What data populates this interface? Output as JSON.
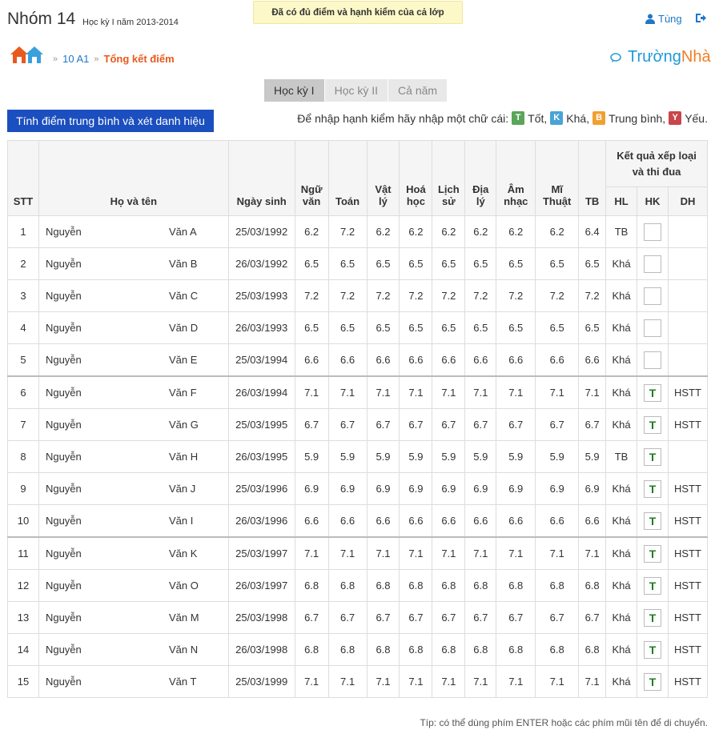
{
  "header": {
    "group": "Nhóm 14",
    "term": "Học kỳ I năm 2013-2014",
    "notice": "Đã có đủ điểm và hạnh kiểm của cả lớp",
    "user": "Tùng",
    "brand_1": "Trường",
    "brand_2": "Nhà"
  },
  "breadcrumb": {
    "class": "10 A1",
    "current": "Tổng kết điểm"
  },
  "tabs": [
    {
      "label": "Học kỳ I",
      "active": true
    },
    {
      "label": "Học kỳ II",
      "active": false
    },
    {
      "label": "Cả năm",
      "active": false
    }
  ],
  "calc_button": "Tính điểm trung bình và xét danh hiệu",
  "hint": {
    "prefix": "Để nhập hạnh kiểm hãy nhập một chữ cái:",
    "items": [
      {
        "letter": "T",
        "label": "Tốt,",
        "color": "#5aa55a"
      },
      {
        "letter": "K",
        "label": "Khá,",
        "color": "#4aa3d6"
      },
      {
        "letter": "B",
        "label": "Trung bình,",
        "color": "#f0a030"
      },
      {
        "letter": "Y",
        "label": "Yếu.",
        "color": "#c9464a"
      }
    ]
  },
  "table": {
    "headers": {
      "stt": "STT",
      "name": "Họ và tên",
      "dob": "Ngày sinh",
      "nguvan_1": "Ngữ",
      "nguvan_2": "văn",
      "toan": "Toán",
      "vatly_1": "Vật",
      "vatly_2": "lý",
      "hoahoc_1": "Hoá",
      "hoahoc_2": "học",
      "lichsu_1": "Lịch",
      "lichsu_2": "sử",
      "diaLy_1": "Địa",
      "diaLy_2": "lý",
      "amnhac_1": "Âm",
      "amnhac_2": "nhạc",
      "mithuat_1": "Mĩ",
      "mithuat_2": "Thuật",
      "tb": "TB",
      "result_1": "Kết quả xếp loại",
      "result_2": "và thi đua",
      "hl": "HL",
      "hk": "HK",
      "dh": "DH"
    },
    "rows": [
      {
        "stt": "1",
        "first": "Nguyễn",
        "last": "Văn A",
        "dob": "25/03/1992",
        "scores": [
          "6.2",
          "7.2",
          "6.2",
          "6.2",
          "6.2",
          "6.2",
          "6.2",
          "6.2"
        ],
        "tb": "6.4",
        "hl": "TB",
        "hk": "",
        "dh": ""
      },
      {
        "stt": "2",
        "first": "Nguyễn",
        "last": "Văn B",
        "dob": "26/03/1992",
        "scores": [
          "6.5",
          "6.5",
          "6.5",
          "6.5",
          "6.5",
          "6.5",
          "6.5",
          "6.5"
        ],
        "tb": "6.5",
        "hl": "Khá",
        "hk": "",
        "dh": ""
      },
      {
        "stt": "3",
        "first": "Nguyễn",
        "last": "Văn C",
        "dob": "25/03/1993",
        "scores": [
          "7.2",
          "7.2",
          "7.2",
          "7.2",
          "7.2",
          "7.2",
          "7.2",
          "7.2"
        ],
        "tb": "7.2",
        "hl": "Khá",
        "hk": "",
        "dh": ""
      },
      {
        "stt": "4",
        "first": "Nguyễn",
        "last": "Văn D",
        "dob": "26/03/1993",
        "scores": [
          "6.5",
          "6.5",
          "6.5",
          "6.5",
          "6.5",
          "6.5",
          "6.5",
          "6.5"
        ],
        "tb": "6.5",
        "hl": "Khá",
        "hk": "",
        "dh": ""
      },
      {
        "stt": "5",
        "first": "Nguyễn",
        "last": "Văn E",
        "dob": "25/03/1994",
        "scores": [
          "6.6",
          "6.6",
          "6.6",
          "6.6",
          "6.6",
          "6.6",
          "6.6",
          "6.6"
        ],
        "tb": "6.6",
        "hl": "Khá",
        "hk": "",
        "dh": ""
      },
      {
        "stt": "6",
        "first": "Nguyễn",
        "last": "Văn F",
        "dob": "26/03/1994",
        "scores": [
          "7.1",
          "7.1",
          "7.1",
          "7.1",
          "7.1",
          "7.1",
          "7.1",
          "7.1"
        ],
        "tb": "7.1",
        "hl": "Khá",
        "hk": "T",
        "dh": "HSTT"
      },
      {
        "stt": "7",
        "first": "Nguyễn",
        "last": "Văn G",
        "dob": "25/03/1995",
        "scores": [
          "6.7",
          "6.7",
          "6.7",
          "6.7",
          "6.7",
          "6.7",
          "6.7",
          "6.7"
        ],
        "tb": "6.7",
        "hl": "Khá",
        "hk": "T",
        "dh": "HSTT"
      },
      {
        "stt": "8",
        "first": "Nguyễn",
        "last": "Văn H",
        "dob": "26/03/1995",
        "scores": [
          "5.9",
          "5.9",
          "5.9",
          "5.9",
          "5.9",
          "5.9",
          "5.9",
          "5.9"
        ],
        "tb": "5.9",
        "hl": "TB",
        "hk": "T",
        "dh": ""
      },
      {
        "stt": "9",
        "first": "Nguyễn",
        "last": "Văn J",
        "dob": "25/03/1996",
        "scores": [
          "6.9",
          "6.9",
          "6.9",
          "6.9",
          "6.9",
          "6.9",
          "6.9",
          "6.9"
        ],
        "tb": "6.9",
        "hl": "Khá",
        "hk": "T",
        "dh": "HSTT"
      },
      {
        "stt": "10",
        "first": "Nguyễn",
        "last": "Văn I",
        "dob": "26/03/1996",
        "scores": [
          "6.6",
          "6.6",
          "6.6",
          "6.6",
          "6.6",
          "6.6",
          "6.6",
          "6.6"
        ],
        "tb": "6.6",
        "hl": "Khá",
        "hk": "T",
        "dh": "HSTT"
      },
      {
        "stt": "11",
        "first": "Nguyễn",
        "last": "Văn K",
        "dob": "25/03/1997",
        "scores": [
          "7.1",
          "7.1",
          "7.1",
          "7.1",
          "7.1",
          "7.1",
          "7.1",
          "7.1"
        ],
        "tb": "7.1",
        "hl": "Khá",
        "hk": "T",
        "dh": "HSTT"
      },
      {
        "stt": "12",
        "first": "Nguyễn",
        "last": "Văn O",
        "dob": "26/03/1997",
        "scores": [
          "6.8",
          "6.8",
          "6.8",
          "6.8",
          "6.8",
          "6.8",
          "6.8",
          "6.8"
        ],
        "tb": "6.8",
        "hl": "Khá",
        "hk": "T",
        "dh": "HSTT"
      },
      {
        "stt": "13",
        "first": "Nguyễn",
        "last": "Văn M",
        "dob": "25/03/1998",
        "scores": [
          "6.7",
          "6.7",
          "6.7",
          "6.7",
          "6.7",
          "6.7",
          "6.7",
          "6.7"
        ],
        "tb": "6.7",
        "hl": "Khá",
        "hk": "T",
        "dh": "HSTT"
      },
      {
        "stt": "14",
        "first": "Nguyễn",
        "last": "Văn N",
        "dob": "26/03/1998",
        "scores": [
          "6.8",
          "6.8",
          "6.8",
          "6.8",
          "6.8",
          "6.8",
          "6.8",
          "6.8"
        ],
        "tb": "6.8",
        "hl": "Khá",
        "hk": "T",
        "dh": "HSTT"
      },
      {
        "stt": "15",
        "first": "Nguyễn",
        "last": "Văn T",
        "dob": "25/03/1999",
        "scores": [
          "7.1",
          "7.1",
          "7.1",
          "7.1",
          "7.1",
          "7.1",
          "7.1",
          "7.1"
        ],
        "tb": "7.1",
        "hl": "Khá",
        "hk": "T",
        "dh": "HSTT"
      }
    ]
  },
  "tip": "Típ: có thể dùng phím ENTER hoặc các phím mũi tên để di chuyển."
}
